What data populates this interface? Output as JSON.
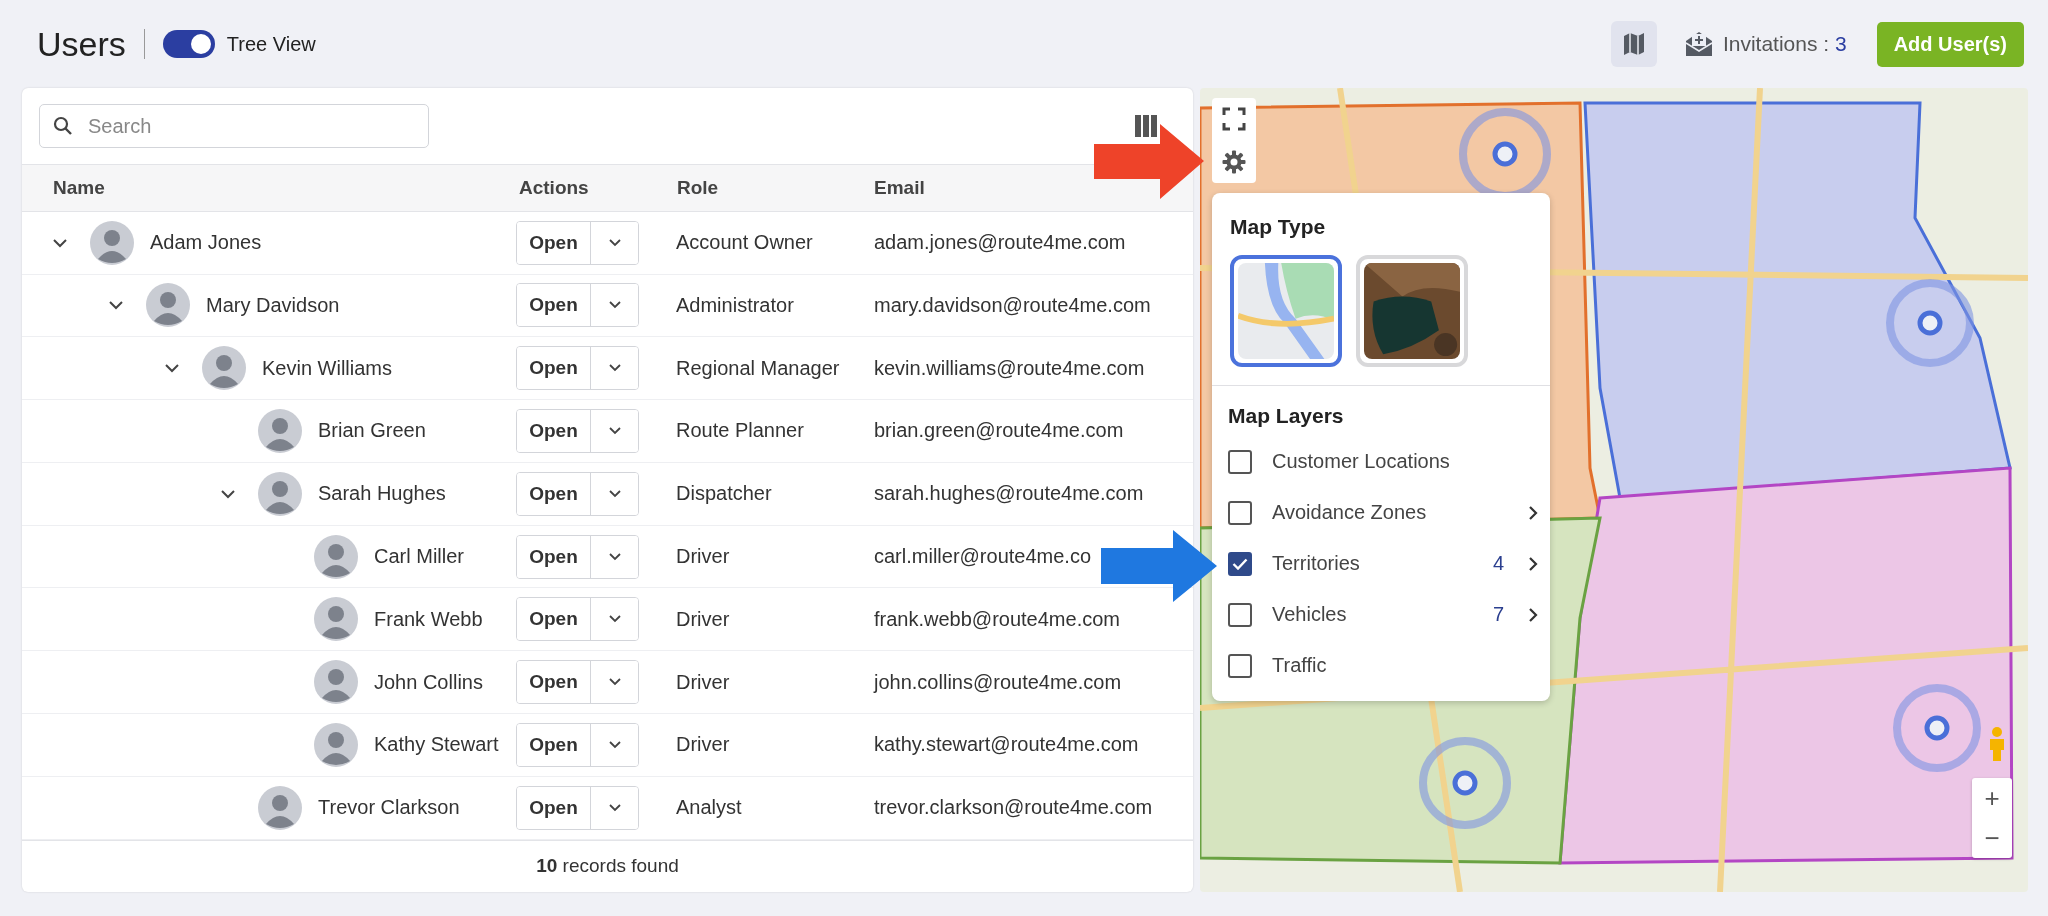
{
  "header": {
    "title": "Users",
    "tree_view": {
      "label": "Tree View",
      "on": true
    },
    "map_view": {
      "selected": true
    },
    "invitations": {
      "label": "Invitations :",
      "count": "3"
    },
    "add_button": "Add User(s)"
  },
  "search": {
    "placeholder": "Search"
  },
  "table": {
    "columns": [
      "Name",
      "Actions",
      "Role",
      "Email"
    ],
    "rows": [
      {
        "name": "Adam Jones",
        "action": "Open",
        "role": "Account Owner",
        "email": "adam.jones@route4me.com",
        "expanded": true,
        "children": [
          {
            "name": "Mary Davidson",
            "action": "Open",
            "role": "Administrator",
            "email": "mary.davidson@route4me.com",
            "expanded": true,
            "children": [
              {
                "name": "Kevin Williams",
                "action": "Open",
                "role": "Regional Manager",
                "email": "kevin.williams@route4me.com",
                "expanded": true,
                "children": [
                  {
                    "name": "Brian Green",
                    "action": "Open",
                    "role": "Route Planner",
                    "email": "brian.green@route4me.com"
                  },
                  {
                    "name": "Sarah Hughes",
                    "action": "Open",
                    "role": "Dispatcher",
                    "email": "sarah.hughes@route4me.com",
                    "expanded": true,
                    "children": [
                      {
                        "name": "Carl Miller",
                        "action": "Open",
                        "role": "Driver",
                        "email": "carl.miller@route4me.co"
                      },
                      {
                        "name": "Frank Webb",
                        "action": "Open",
                        "role": "Driver",
                        "email": "frank.webb@route4me.com"
                      },
                      {
                        "name": "John Collins",
                        "action": "Open",
                        "role": "Driver",
                        "email": "john.collins@route4me.com"
                      },
                      {
                        "name": "Kathy Stewart",
                        "action": "Open",
                        "role": "Driver",
                        "email": "kathy.stewart@route4me.com"
                      }
                    ]
                  },
                  {
                    "name": "Trevor Clarkson",
                    "action": "Open",
                    "role": "Analyst",
                    "email": "trevor.clarkson@route4me.com"
                  }
                ]
              }
            ]
          }
        ]
      }
    ],
    "footer": "**10** records found"
  },
  "map": {
    "kind": "picture",
    "zoom_in": "+",
    "zoom_out": "−",
    "panel": {
      "map_type_title": "Map Type",
      "map_types": [
        {
          "kind": "roadmap",
          "selected": true
        },
        {
          "kind": "satellite",
          "selected": false
        }
      ],
      "layers_title": "Map Layers",
      "layers": [
        {
          "label": "Customer Locations",
          "checked": false
        },
        {
          "label": "Avoidance Zones",
          "checked": false,
          "submenu": true
        },
        {
          "label": "Territories",
          "checked": true,
          "count": "4",
          "submenu": true
        },
        {
          "label": "Vehicles",
          "checked": false,
          "count": "7",
          "submenu": true
        },
        {
          "label": "Traffic",
          "checked": false
        }
      ]
    }
  }
}
